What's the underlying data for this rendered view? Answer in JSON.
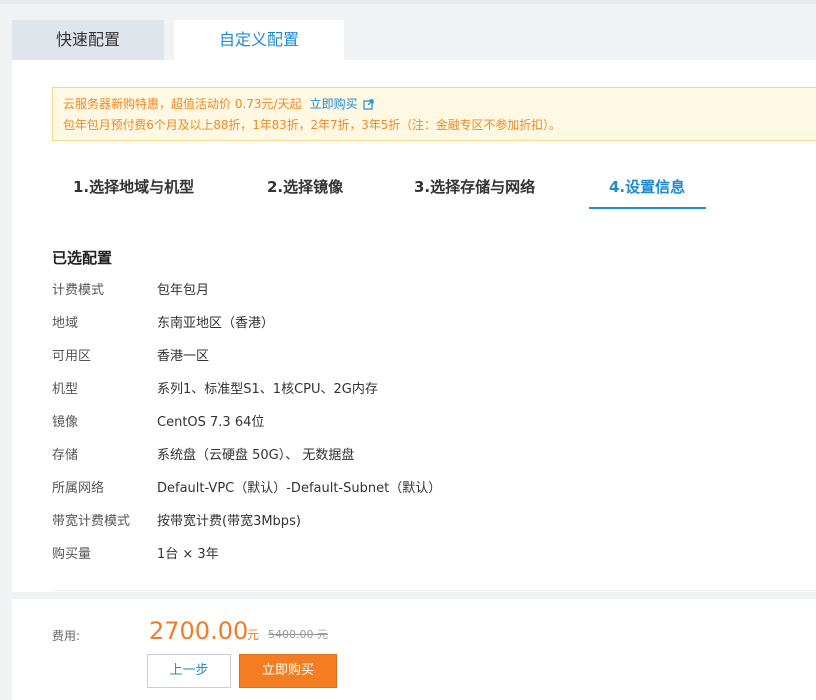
{
  "tabs": {
    "quick": "快速配置",
    "custom": "自定义配置"
  },
  "notice": {
    "line1": "云服务器新购特惠，超值活动价 0.73元/天起",
    "buy_link": "立即购买",
    "line2": "包年包月预付费6个月及以上88折，1年83折，2年7折，3年5折（注：金融专区不参加折扣）。"
  },
  "steps": [
    {
      "label": "1.选择地域与机型"
    },
    {
      "label": "2.选择镜像"
    },
    {
      "label": "3.选择存储与网络"
    },
    {
      "label": "4.设置信息",
      "active": true
    }
  ],
  "selected_config": {
    "title": "已选配置",
    "rows": [
      {
        "label": "计费模式",
        "value": "包年包月"
      },
      {
        "label": "地域",
        "value": "东南亚地区（香港）"
      },
      {
        "label": "可用区",
        "value": "香港一区"
      },
      {
        "label": "机型",
        "value": "系列1、标准型S1、1核CPU、2G内存"
      },
      {
        "label": "镜像",
        "value": "CentOS 7.3 64位"
      },
      {
        "label": "存储",
        "value": "系统盘（云硬盘 50G）、 无数据盘"
      },
      {
        "label": "所属网络",
        "value": "Default-VPC（默认）-Default-Subnet（默认）"
      },
      {
        "label": "带宽计费模式",
        "value": "按带宽计费(带宽3Mbps)"
      },
      {
        "label": "购买量",
        "value": "1台 × 3年"
      }
    ]
  },
  "footer": {
    "fee_label": "费用:",
    "price": "2700.00",
    "price_unit": "元",
    "original_price": "5400.00 元",
    "prev_button": "上一步",
    "buy_button": "立即购买"
  },
  "colors": {
    "accent_blue": "#1e8bd3",
    "price_orange": "#f17c27",
    "notice_bg": "#fff8e3"
  }
}
